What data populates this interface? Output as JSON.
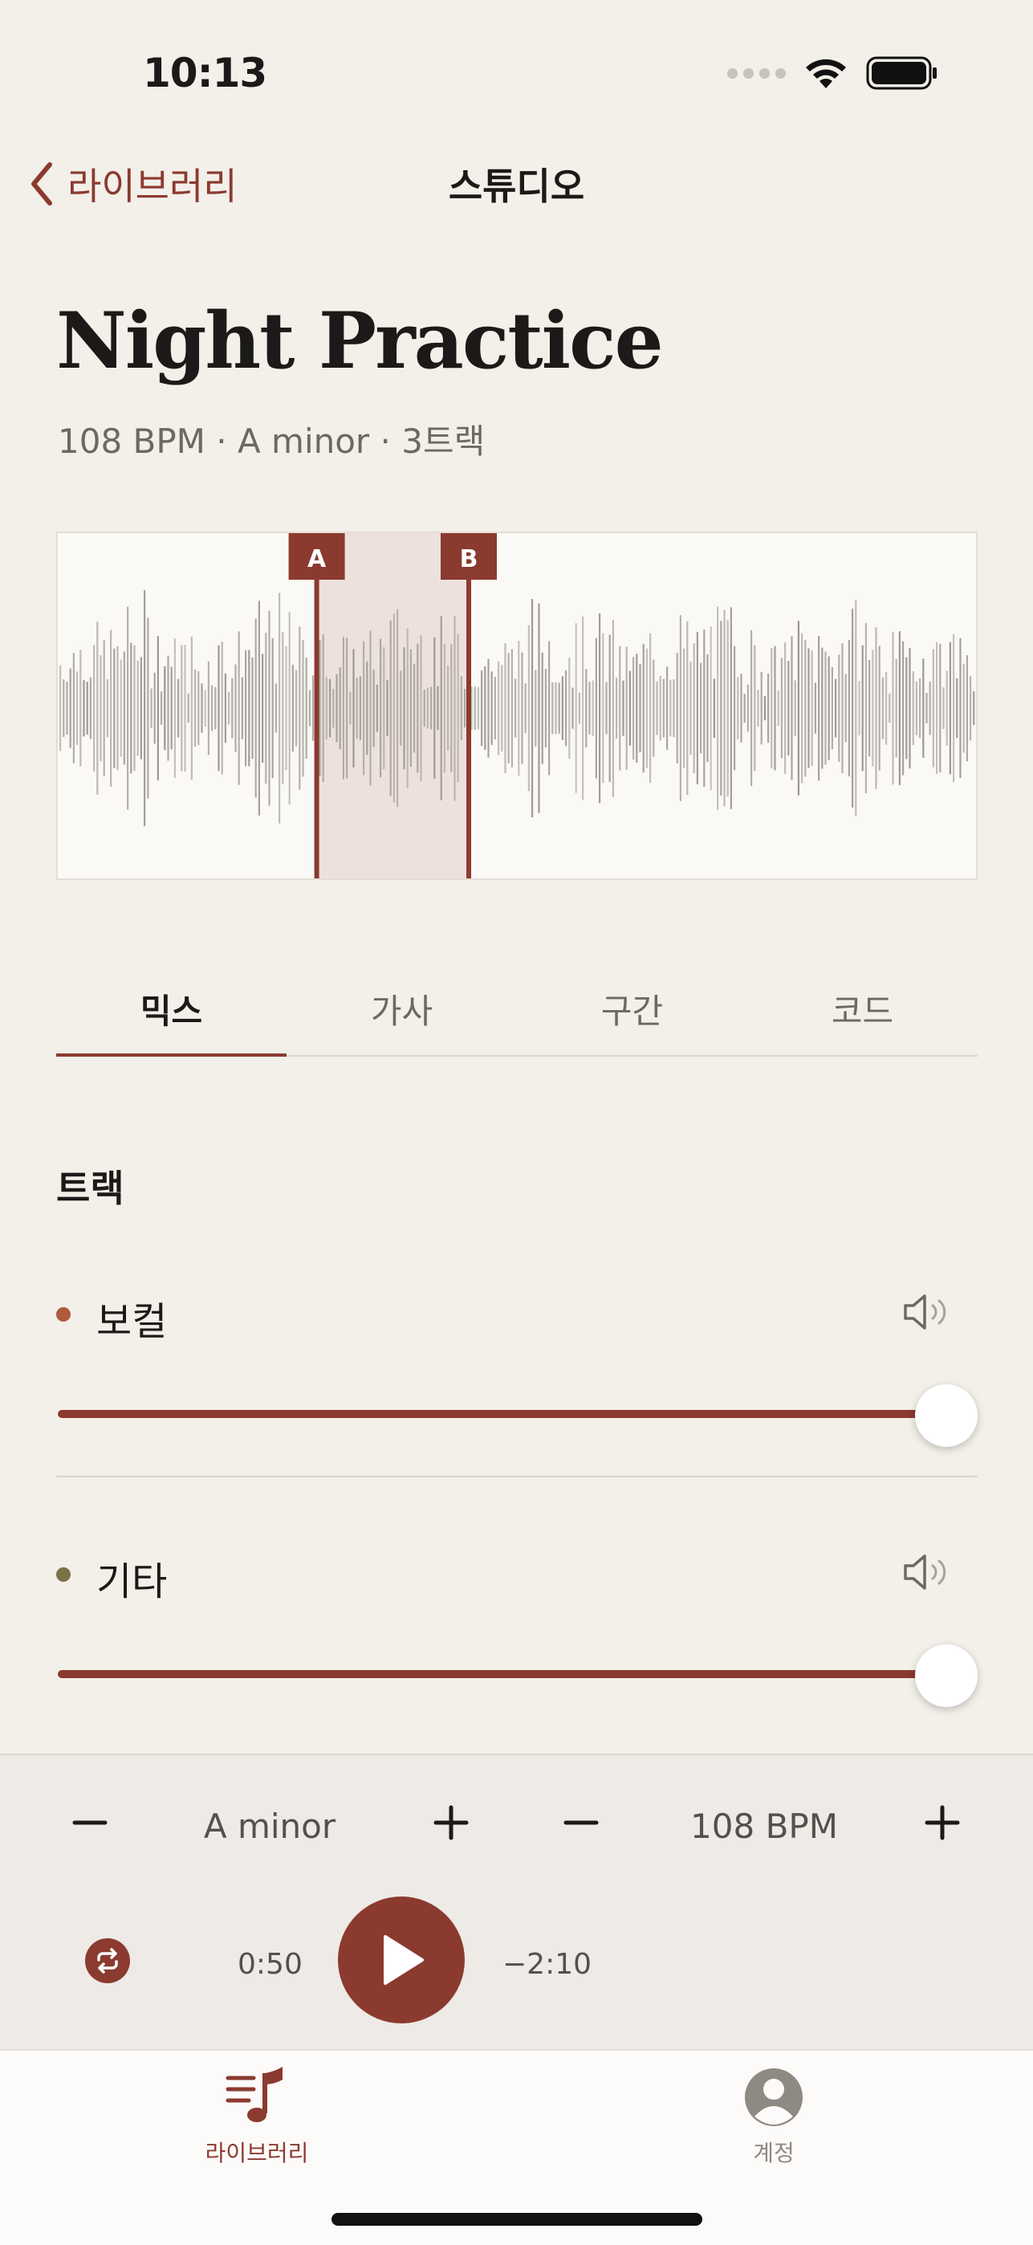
{
  "status": {
    "time": "10:13"
  },
  "nav": {
    "back_label": "라이브러리",
    "title": "스튜디오"
  },
  "song": {
    "title": "Night Practice",
    "meta": "108 BPM · A minor · 3트랙"
  },
  "loop": {
    "start_label": "A",
    "end_label": "B",
    "start_fraction": 0.281,
    "end_fraction": 0.446
  },
  "tabs": [
    {
      "label": "믹스",
      "active": true
    },
    {
      "label": "가사",
      "active": false
    },
    {
      "label": "구간",
      "active": false
    },
    {
      "label": "코드",
      "active": false
    }
  ],
  "tracks_section": {
    "title": "트랙"
  },
  "tracks": [
    {
      "name": "보컬",
      "color": "#b05a3e",
      "volume": 1.0
    },
    {
      "name": "기타",
      "color": "#7a7245",
      "volume": 1.0
    }
  ],
  "controls": {
    "key": "A minor",
    "tempo": "108 BPM",
    "elapsed": "0:50",
    "remaining": "−2:10"
  },
  "tabbar": {
    "items": [
      {
        "label": "라이브러리",
        "icon": "music-list-icon",
        "active": true
      },
      {
        "label": "계정",
        "icon": "person-icon",
        "active": false
      }
    ]
  },
  "colors": {
    "accent": "#8b3a2f",
    "background": "#f3efe9"
  }
}
